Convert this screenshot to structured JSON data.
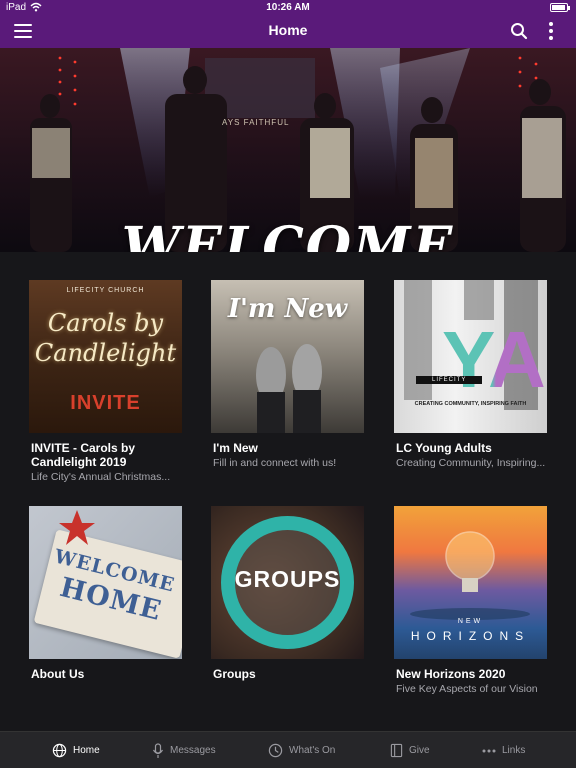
{
  "status_bar": {
    "device": "iPad",
    "time": "10:26 AM"
  },
  "nav": {
    "title": "Home",
    "menu_icon": "hamburger-icon",
    "search_icon": "search-icon",
    "more_icon": "more-vertical-icon"
  },
  "hero": {
    "title": "WELCOME",
    "banner_text": "AYS FAITHFUL"
  },
  "cards": [
    {
      "title": "INVITE - Carols by Candlelight 2019",
      "subtitle": "Life City's Annual Christmas...",
      "art": {
        "church": "LIFECITY CHURCH",
        "script": "Carols by Candlelight",
        "invite": "INVITE"
      }
    },
    {
      "title": "I'm New",
      "subtitle": "Fill in and connect with us!",
      "art": {
        "script": "I'm New"
      }
    },
    {
      "title": "LC Young Adults",
      "subtitle": "Creating Community, Inspiring...",
      "art": {
        "big": "YA",
        "lifecity": "LIFECITY",
        "tagline": "CREATING COMMUNITY, INSPIRING FAITH"
      }
    },
    {
      "title": "About Us",
      "subtitle": "",
      "art": {
        "line1": "WELCOME",
        "line2": "HOME"
      }
    },
    {
      "title": "Groups",
      "subtitle": "",
      "art": {
        "word": "GROUPS"
      }
    },
    {
      "title": "New Horizons 2020",
      "subtitle": "Five Key Aspects of our Vision",
      "art": {
        "line1": "NEW",
        "line2": "HORIZONS"
      }
    }
  ],
  "tabs": [
    {
      "label": "Home",
      "icon": "globe-icon",
      "active": true
    },
    {
      "label": "Messages",
      "icon": "microphone-icon",
      "active": false
    },
    {
      "label": "What's On",
      "icon": "clock-icon",
      "active": false
    },
    {
      "label": "Give",
      "icon": "book-icon",
      "active": false
    },
    {
      "label": "Links",
      "icon": "more-horizontal-icon",
      "active": false
    }
  ],
  "colors": {
    "nav_bar": "#5a1a7a",
    "background": "#17171a",
    "tab_bar": "#262629",
    "groups_ring": "#2fb3a8",
    "ya_accent_teal": "#5cc3b5",
    "ya_accent_purple": "#b26fc5"
  }
}
